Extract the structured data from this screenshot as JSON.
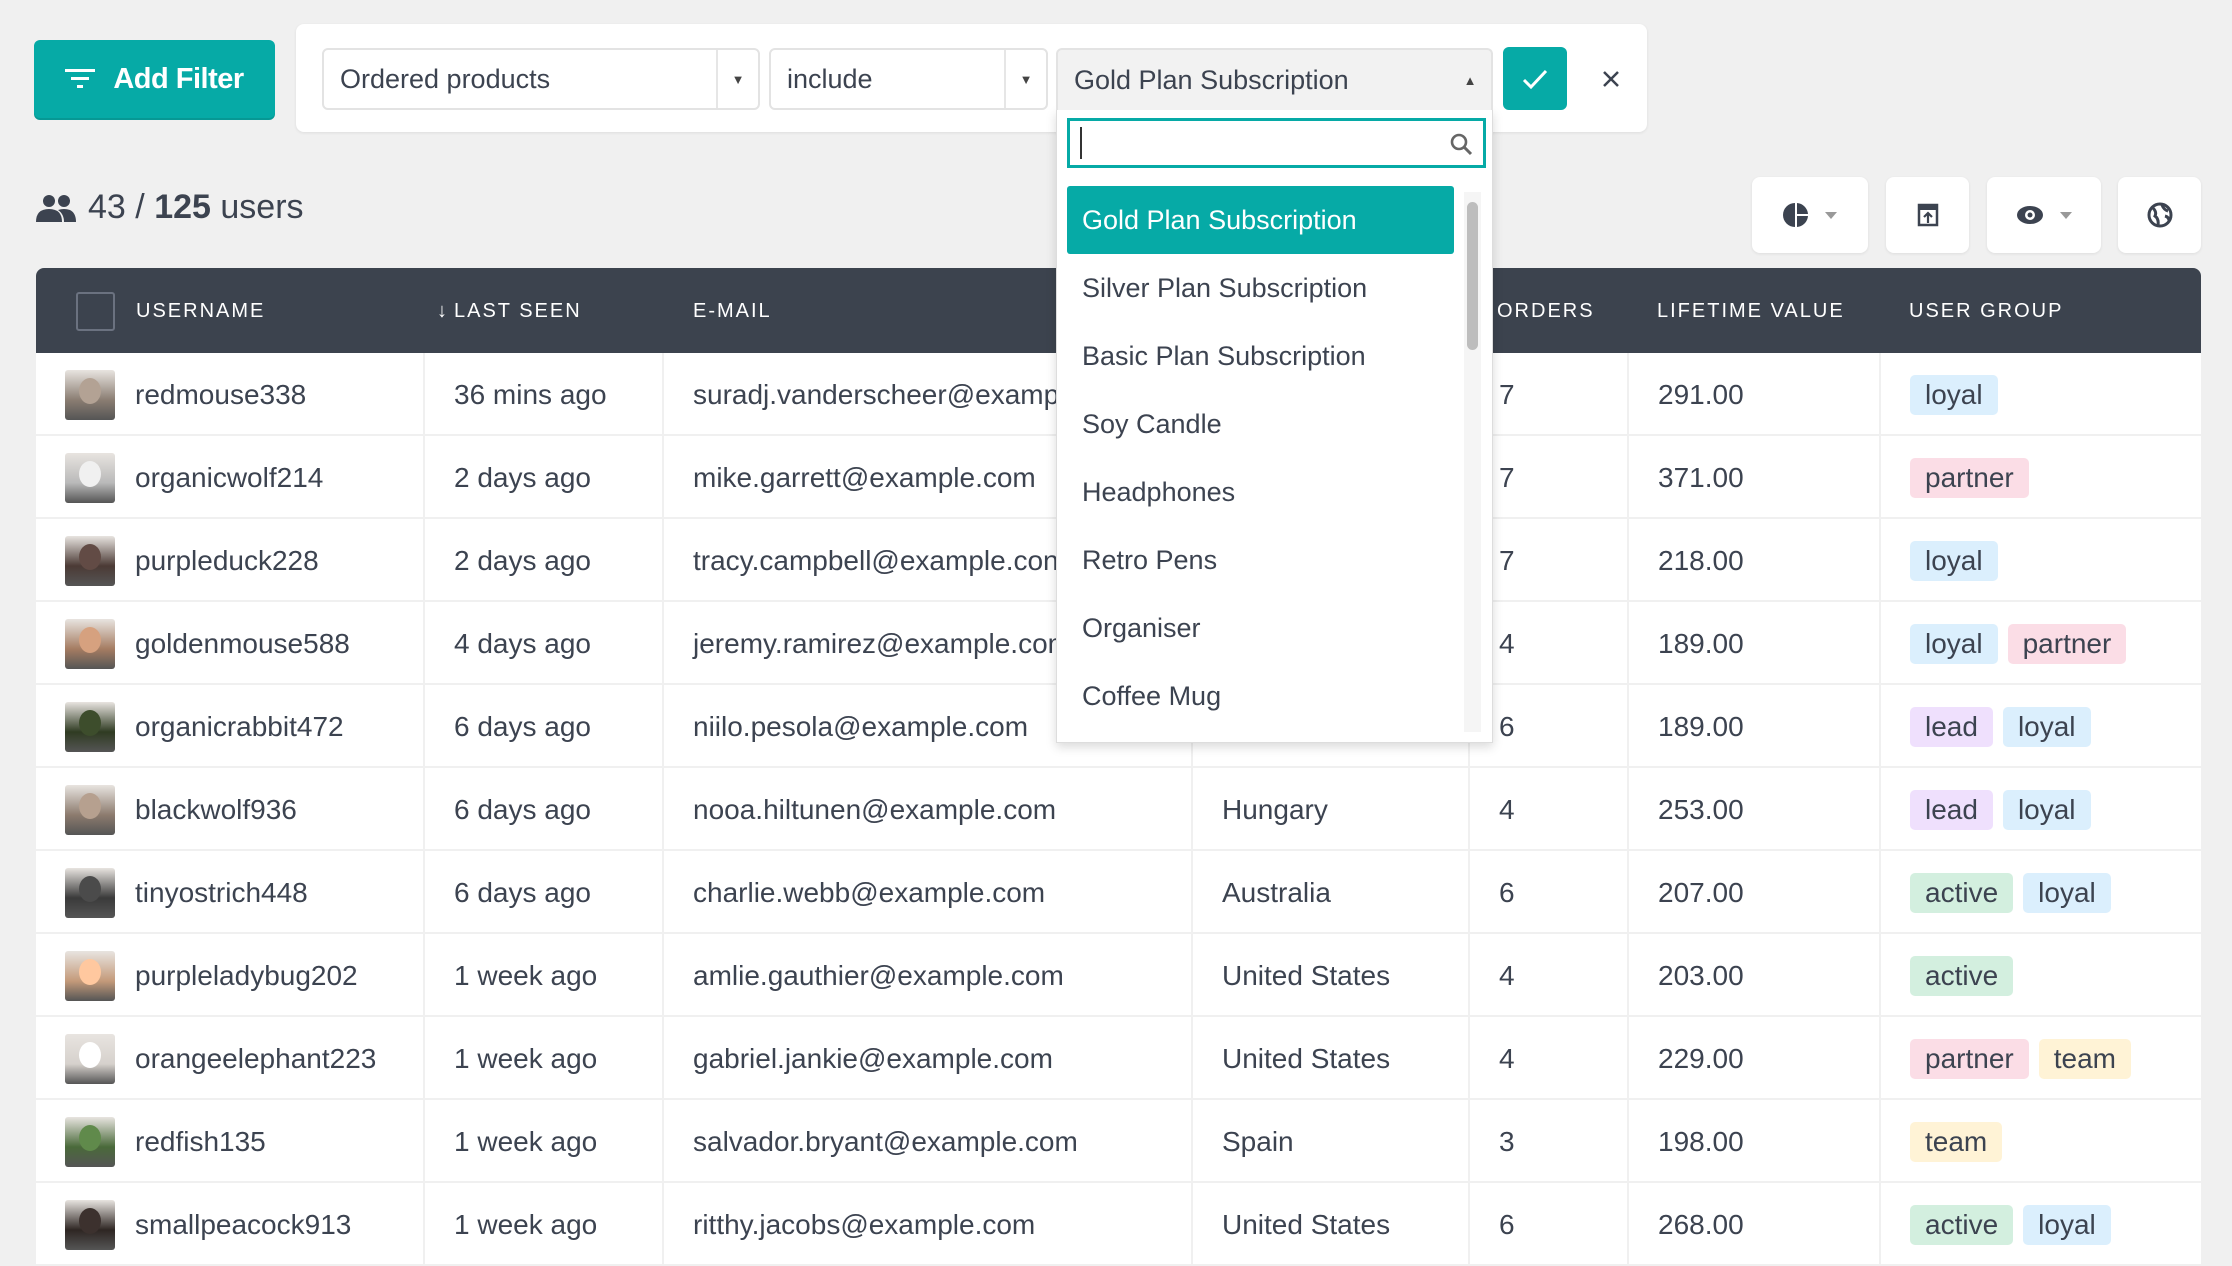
{
  "filter": {
    "add_filter_label": "Add Filter",
    "field_value": "Ordered products",
    "operator_value": "include",
    "product_value": "Gold Plan Subscription",
    "search_placeholder": "",
    "options": [
      "Gold Plan Subscription",
      "Silver Plan Subscription",
      "Basic Plan Subscription",
      "Soy Candle",
      "Headphones",
      "Retro Pens",
      "Organiser",
      "Coffee Mug"
    ],
    "selected_option": "Gold Plan Subscription"
  },
  "summary": {
    "filtered": "43",
    "separator": "/",
    "total": "125",
    "unit": "users"
  },
  "toolbar": {
    "icons": [
      "segment-chart-icon",
      "export-icon",
      "eye-icon",
      "globe-icon"
    ]
  },
  "colors": {
    "accent": "#06aaa6",
    "header": "#3c434e",
    "loyal": "#dbeffd",
    "partner": "#fbdde6",
    "lead": "#efe0fd",
    "active": "#d3efdf",
    "team": "#fff3d6"
  },
  "table": {
    "headers": {
      "username": "USERNAME",
      "last_seen": "LAST SEEN",
      "sort_arrow": "↓",
      "email": "E-MAIL",
      "orders": "ORDERS",
      "lifetime_value": "LIFETIME VALUE",
      "user_group": "USER GROUP"
    },
    "rows": [
      {
        "username": "redmouse338",
        "last_seen": "36 mins ago",
        "email": "suradj.vanderscheer@examp",
        "country": "",
        "orders": "7",
        "value": "291.00",
        "groups": [
          "loyal"
        ]
      },
      {
        "username": "organicwolf214",
        "last_seen": "2 days ago",
        "email": "mike.garrett@example.com",
        "country": "",
        "orders": "7",
        "value": "371.00",
        "groups": [
          "partner"
        ]
      },
      {
        "username": "purpleduck228",
        "last_seen": "2 days ago",
        "email": "tracy.campbell@example.con",
        "country": "",
        "orders": "7",
        "value": "218.00",
        "groups": [
          "loyal"
        ]
      },
      {
        "username": "goldenmouse588",
        "last_seen": "4 days ago",
        "email": "jeremy.ramirez@example.com",
        "country": "",
        "orders": "4",
        "value": "189.00",
        "groups": [
          "loyal",
          "partner"
        ]
      },
      {
        "username": "organicrabbit472",
        "last_seen": "6 days ago",
        "email": "niilo.pesola@example.com",
        "country": "",
        "orders": "6",
        "value": "189.00",
        "groups": [
          "lead",
          "loyal"
        ]
      },
      {
        "username": "blackwolf936",
        "last_seen": "6 days ago",
        "email": "nooa.hiltunen@example.com",
        "country": "Hungary",
        "orders": "4",
        "value": "253.00",
        "groups": [
          "lead",
          "loyal"
        ]
      },
      {
        "username": "tinyostrich448",
        "last_seen": "6 days ago",
        "email": "charlie.webb@example.com",
        "country": "Australia",
        "orders": "6",
        "value": "207.00",
        "groups": [
          "active",
          "loyal"
        ]
      },
      {
        "username": "purpleladybug202",
        "last_seen": "1 week ago",
        "email": "amlie.gauthier@example.com",
        "country": "United States",
        "orders": "4",
        "value": "203.00",
        "groups": [
          "active"
        ]
      },
      {
        "username": "orangeelephant223",
        "last_seen": "1 week ago",
        "email": "gabriel.jankie@example.com",
        "country": "United States",
        "orders": "4",
        "value": "229.00",
        "groups": [
          "partner",
          "team"
        ]
      },
      {
        "username": "redfish135",
        "last_seen": "1 week ago",
        "email": "salvador.bryant@example.com",
        "country": "Spain",
        "orders": "3",
        "value": "198.00",
        "groups": [
          "team"
        ]
      },
      {
        "username": "smallpeacock913",
        "last_seen": "1 week ago",
        "email": "ritthy.jacobs@example.com",
        "country": "United States",
        "orders": "6",
        "value": "268.00",
        "groups": [
          "active",
          "loyal"
        ]
      }
    ]
  }
}
